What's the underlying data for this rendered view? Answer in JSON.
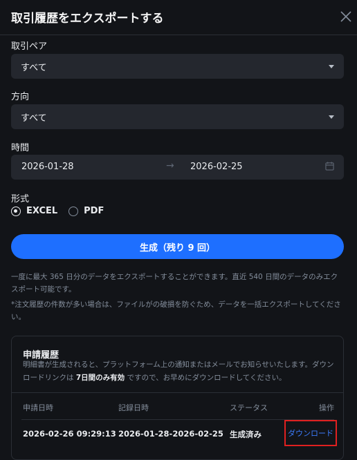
{
  "dialog": {
    "title": "取引履歴をエクスポートする"
  },
  "form": {
    "pair_label": "取引ペア",
    "pair_value": "すべて",
    "direction_label": "方向",
    "direction_value": "すべて",
    "time_label": "時間",
    "start_date": "2026-01-28",
    "end_date": "2026-02-25",
    "range_arrow": "→",
    "format_label": "形式",
    "format_options": [
      "EXCEL",
      "PDF"
    ],
    "format_selected": "EXCEL",
    "generate_button": "生成（残り 9 回）"
  },
  "notes": {
    "note1": "一度に最大 365 日分のデータをエクスポートすることができます。直近 540 日間のデータのみエクスポート可能です。",
    "note2": "*注文履歴の件数が多い場合は、ファイルがの破損を防ぐため、データを一括エクスポートしてください。"
  },
  "history": {
    "title": "申請履歴",
    "desc_prefix": "明細書が生成されると、プラットフォーム上の通知またはメールでお知らせいたします。ダウンロードリンクは ",
    "desc_bold": "7日間のみ有効",
    "desc_suffix": " ですので、お早めにダウンロードしてください。",
    "columns": [
      "申請日時",
      "記録日時",
      "ステータス",
      "操作"
    ],
    "rows": [
      {
        "applied": "2026-02-26 09:29:13",
        "record_range": "2026-01-28-2026-02-25",
        "status": "生成済み",
        "action": "ダウンロード"
      }
    ]
  },
  "colors": {
    "accent": "#1e6fff",
    "link": "#3d7dff",
    "highlight_border": "#e02020",
    "background": "#121418",
    "field": "#24272e"
  },
  "icons": [
    "close-icon",
    "caret-down-icon",
    "arrow-right-icon",
    "calendar-icon",
    "radio-icon"
  ]
}
